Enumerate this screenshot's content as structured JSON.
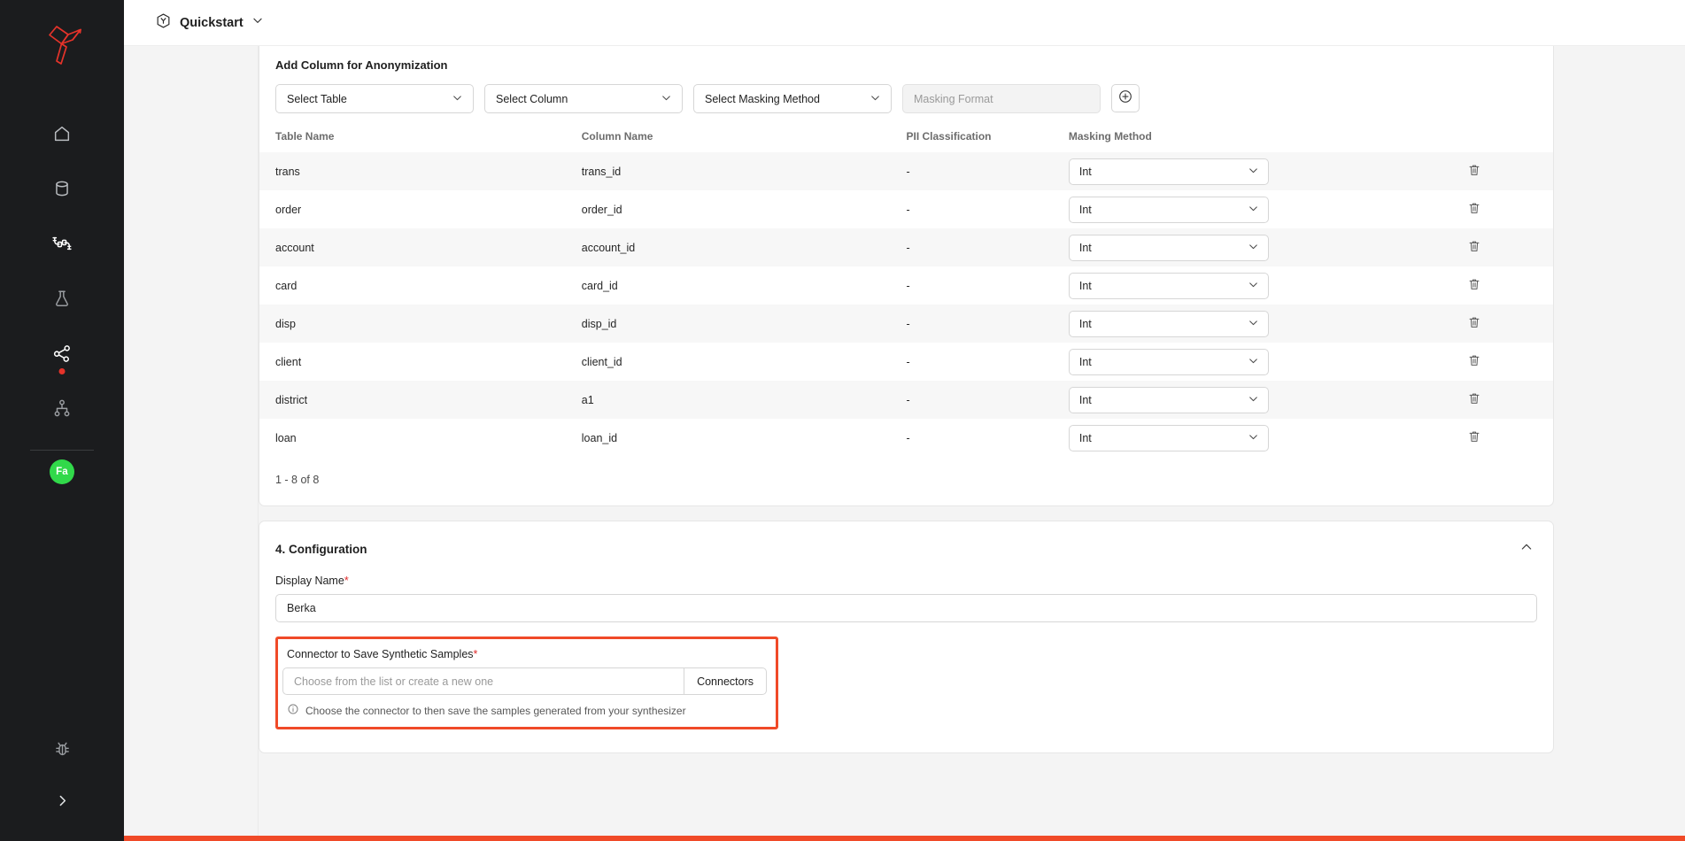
{
  "sidebar": {
    "brand": {
      "icon": "cube-logo-icon",
      "color": "#e5332a"
    },
    "items": [
      {
        "icon": "home-icon",
        "name": "home",
        "active": false,
        "badge": false
      },
      {
        "icon": "database-icon",
        "name": "data-sources",
        "active": false,
        "badge": false
      },
      {
        "icon": "plugs-icon",
        "name": "connectors",
        "active": true,
        "badge": false
      },
      {
        "icon": "flask-icon",
        "name": "experiments",
        "active": false,
        "badge": false
      },
      {
        "icon": "share-nodes-icon",
        "name": "synthesizers",
        "active": false,
        "badge": true
      },
      {
        "icon": "sitemap-icon",
        "name": "pipelines",
        "active": false,
        "badge": false
      }
    ],
    "avatar": {
      "initials": "Fa",
      "color": "#31d94a"
    },
    "bug_icon": "bug-icon",
    "expand_icon": "chevron-right-icon"
  },
  "topbar": {
    "workspace_icon": "cube-hex-icon",
    "workspace_label": "Quickstart",
    "chevron_icon": "chevron-down-icon"
  },
  "anonymization": {
    "title": "Add Column for Anonymization",
    "controls": {
      "select_table": "Select Table",
      "select_column": "Select Column",
      "select_masking_method": "Select Masking Method",
      "masking_format_placeholder": "Masking Format",
      "masking_format_value": "",
      "add_icon": "plus-circle-icon"
    },
    "columns": [
      "Table Name",
      "Column Name",
      "PII Classification",
      "Masking Method",
      ""
    ],
    "rows": [
      {
        "table": "trans",
        "column": "trans_id",
        "pii": "-",
        "masking": "Int",
        "delete_icon": "trash-icon"
      },
      {
        "table": "order",
        "column": "order_id",
        "pii": "-",
        "masking": "Int",
        "delete_icon": "trash-icon"
      },
      {
        "table": "account",
        "column": "account_id",
        "pii": "-",
        "masking": "Int",
        "delete_icon": "trash-icon"
      },
      {
        "table": "card",
        "column": "card_id",
        "pii": "-",
        "masking": "Int",
        "delete_icon": "trash-icon"
      },
      {
        "table": "disp",
        "column": "disp_id",
        "pii": "-",
        "masking": "Int",
        "delete_icon": "trash-icon"
      },
      {
        "table": "client",
        "column": "client_id",
        "pii": "-",
        "masking": "Int",
        "delete_icon": "trash-icon"
      },
      {
        "table": "district",
        "column": "a1",
        "pii": "-",
        "masking": "Int",
        "delete_icon": "trash-icon"
      },
      {
        "table": "loan",
        "column": "loan_id",
        "pii": "-",
        "masking": "Int",
        "delete_icon": "trash-icon"
      }
    ],
    "pagination": "1 - 8 of 8"
  },
  "configuration": {
    "title": "4. Configuration",
    "collapse_icon": "chevron-up-icon",
    "display_name": {
      "label": "Display Name",
      "required_marker": "*",
      "value": "Berka"
    },
    "connector": {
      "label": "Connector to Save Synthetic Samples",
      "required_marker": "*",
      "input_placeholder": "Choose from the list or create a new one",
      "input_value": "",
      "button_label": "Connectors",
      "hint_icon": "info-circle-icon",
      "hint": "Choose the connector to then save the samples generated from your synthesizer",
      "highlight_color": "#f04a28"
    }
  }
}
